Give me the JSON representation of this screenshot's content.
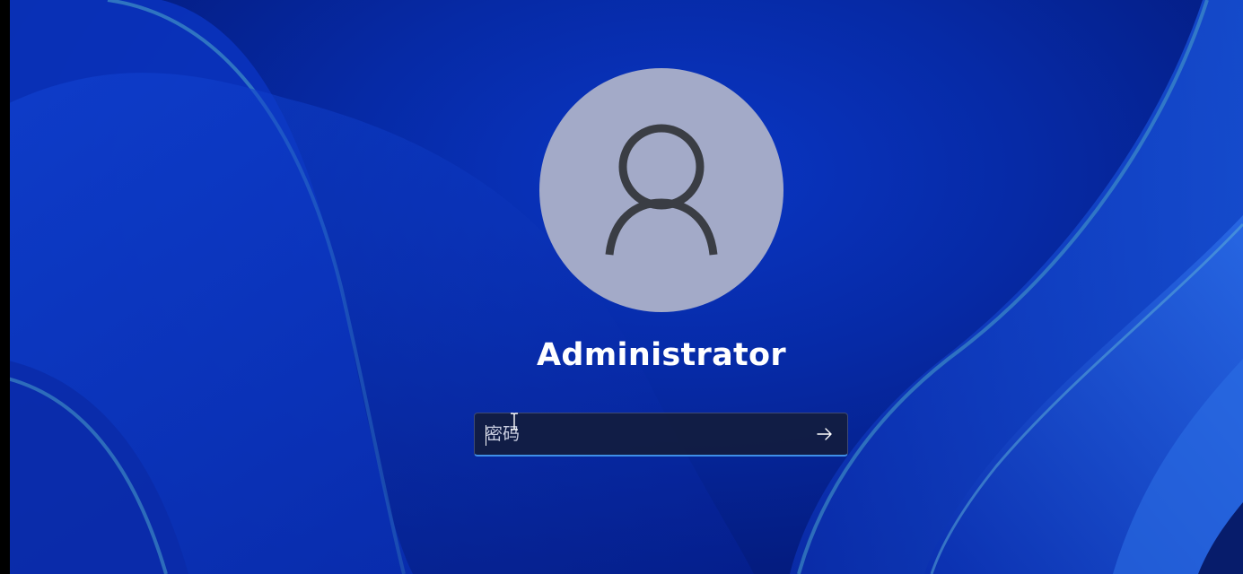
{
  "lock_screen": {
    "user": {
      "name": "Administrator",
      "avatar_icon": "user-silhouette-icon"
    },
    "password": {
      "placeholder": "密码",
      "value": "",
      "submit_icon": "arrow-right-icon"
    },
    "colors": {
      "background": "#062aa6",
      "avatar_bg": "#a3aac8",
      "avatar_glyph": "#3a3d44",
      "input_accent": "#3f8fe8",
      "text": "#ffffff"
    }
  }
}
